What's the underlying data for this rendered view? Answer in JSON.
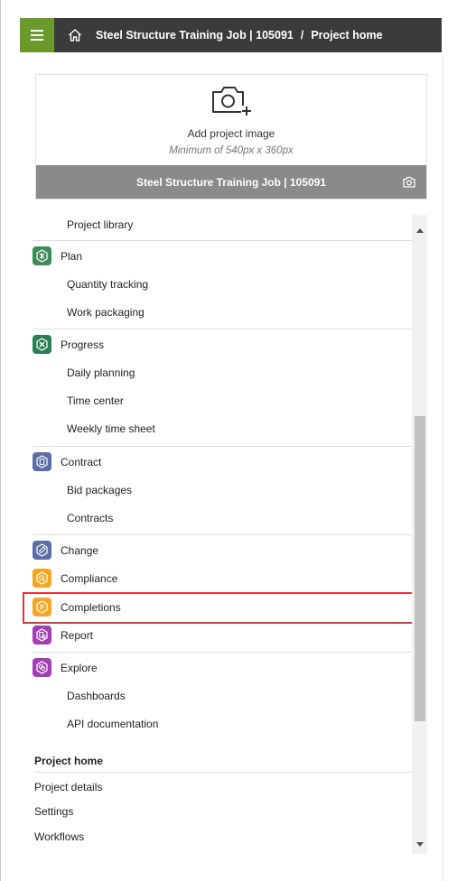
{
  "colors": {
    "topbar": "#3b3b3b",
    "menu_button": "#6a9a2c",
    "card_footer": "#8a8a8a",
    "highlight": "#e0353b",
    "plan_icon": "#3e8a5a",
    "progress_icon": "#2e7d55",
    "contract_icon": "#5b6ea5",
    "change_icon": "#5b6ea5",
    "compliance_icon": "#f5a623",
    "completions_icon": "#f5a623",
    "report_icon": "#a23fb5",
    "explore_icon": "#a23fb5"
  },
  "topbar": {
    "menu_icon": "hamburger-icon",
    "home_icon": "home-icon",
    "breadcrumb_project": "Steel Structure Training Job | 105091",
    "breadcrumb_separator": "/",
    "breadcrumb_page": "Project home"
  },
  "project_card": {
    "upload_icon": "camera-plus-icon",
    "add_image_label": "Add project image",
    "min_size_label": "Minimum of 540px x 360px",
    "project_name": "Steel Structure Training Job | 105091",
    "camera_icon": "camera-icon"
  },
  "nav": {
    "partial_item": "Project library",
    "plan": {
      "label": "Plan",
      "icon": "plan-icon",
      "items": [
        "Quantity tracking",
        "Work packaging"
      ]
    },
    "progress": {
      "label": "Progress",
      "icon": "progress-icon",
      "items": [
        "Daily planning",
        "Time center",
        "Weekly time sheet"
      ]
    },
    "contract": {
      "label": "Contract",
      "icon": "contract-icon",
      "items": [
        "Bid packages",
        "Contracts"
      ]
    },
    "change": {
      "label": "Change",
      "icon": "change-icon"
    },
    "compliance": {
      "label": "Compliance",
      "icon": "compliance-icon"
    },
    "completions": {
      "label": "Completions",
      "icon": "completions-icon"
    },
    "report": {
      "label": "Report",
      "icon": "report-icon"
    },
    "explore": {
      "label": "Explore",
      "icon": "explore-icon",
      "items": [
        "Dashboards",
        "API documentation"
      ]
    },
    "project_home": {
      "heading": "Project home",
      "items": [
        "Project details",
        "Settings",
        "Workflows"
      ]
    }
  }
}
